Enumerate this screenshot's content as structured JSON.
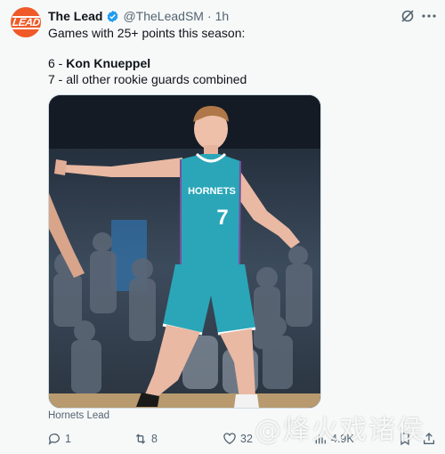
{
  "account": {
    "avatar_text": "LEAD",
    "name": "The Lead",
    "handle": "@TheLeadSM",
    "separator": "·",
    "time": "1h"
  },
  "tweet": {
    "line1": "Games with 25+ points this season:",
    "line2_prefix": "6 - ",
    "line2_name": "Kon Knueppel",
    "line3": "7 - all other rookie guards combined"
  },
  "media": {
    "jersey_team": "HORNETS",
    "jersey_number": "7",
    "caption": "Hornets Lead"
  },
  "actions": {
    "reply_count": "1",
    "retweet_count": "8",
    "like_count": "32",
    "views_count": "4.9K"
  },
  "watermark": "@烽火戏诸侯",
  "colors": {
    "avatar_bg": "#ef5a28",
    "verified_blue": "#1d9bf0",
    "jersey_teal": "#2aa6b8"
  },
  "icons": [
    "grok-icon",
    "more-icon",
    "reply-icon",
    "retweet-icon",
    "like-icon",
    "views-icon",
    "bookmark-icon",
    "share-icon"
  ]
}
